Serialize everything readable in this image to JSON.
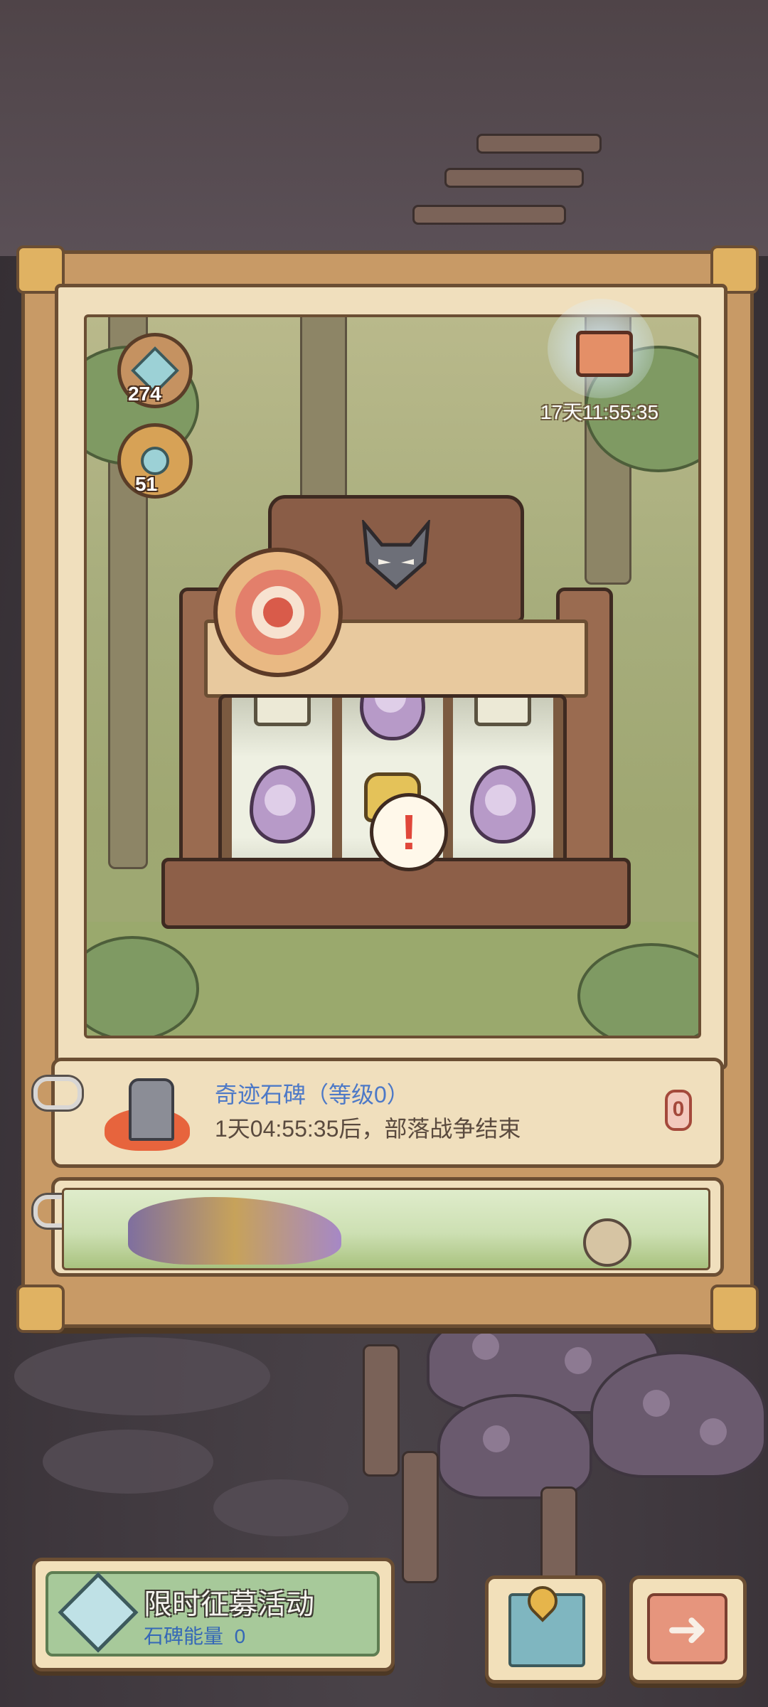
{
  "resources": {
    "gem_count": "274",
    "trophy_count": "51"
  },
  "chest": {
    "timer": "17天11:55:35"
  },
  "monolith_card": {
    "title": "奇迹石碑（等级0）",
    "subtitle": "1天04:55:35后，部落战争结束",
    "count": "0"
  },
  "alert": {
    "symbol": "!"
  },
  "recruit_button": {
    "title": "限时征募活动",
    "energy_label": "石碑能量",
    "energy_value": "0"
  },
  "colors": {
    "title_blue": "#4d79c7",
    "panel_wood": "#c89a66",
    "alert_red": "#e0473a"
  }
}
